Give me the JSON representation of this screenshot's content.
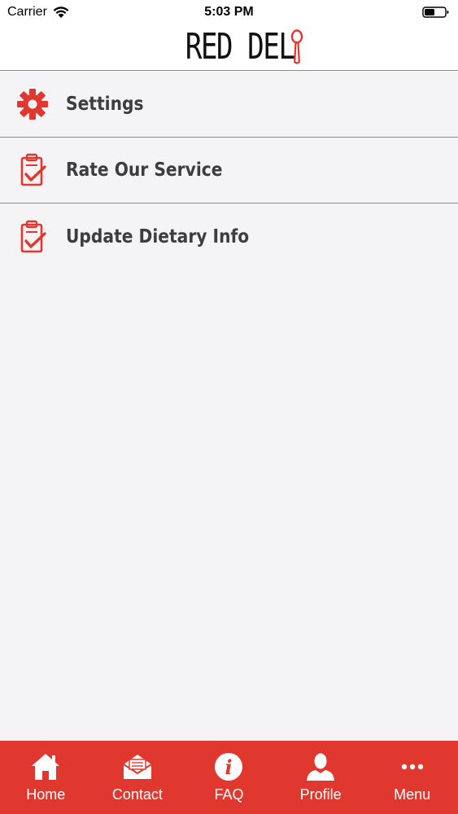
{
  "status_bar": {
    "carrier": "Carrier",
    "time": "5:03 PM"
  },
  "header": {
    "logo_text": "RED DEL",
    "logo_icon": "spoon-icon"
  },
  "colors": {
    "brand_red": "#e0382f",
    "text_dark": "#3d3d3d",
    "background": "#f4f4f6"
  },
  "menu": {
    "items": [
      {
        "label": "Settings",
        "icon": "gear-icon"
      },
      {
        "label": "Rate Our Service",
        "icon": "clipboard-check-icon"
      },
      {
        "label": "Update Dietary Info",
        "icon": "clipboard-check-icon"
      }
    ]
  },
  "tab_bar": {
    "tabs": [
      {
        "label": "Home",
        "icon": "home-icon"
      },
      {
        "label": "Contact",
        "icon": "envelope-icon"
      },
      {
        "label": "FAQ",
        "icon": "info-icon"
      },
      {
        "label": "Profile",
        "icon": "person-icon"
      },
      {
        "label": "Menu",
        "icon": "more-dots-icon"
      }
    ]
  }
}
